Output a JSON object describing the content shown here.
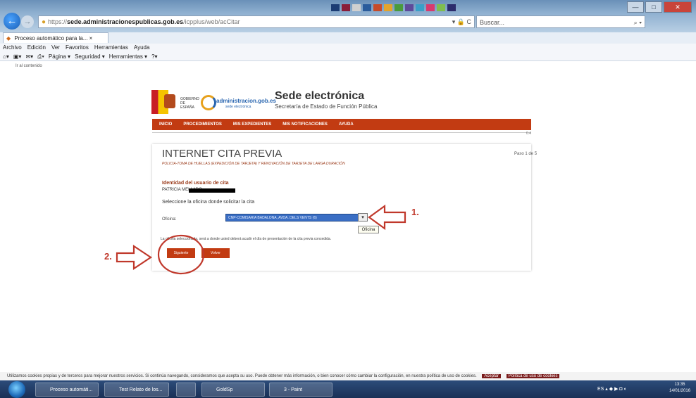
{
  "browser": {
    "url_prefix": "https://",
    "url_host": "sede.administracionespublicas.gob.es",
    "url_path": "/icpplus/web/acCitar",
    "url_controls": "▾ 🔒 C",
    "search_placeholder": "Buscar...",
    "tab_title": "Proceso automático para la... ×",
    "window_controls": [
      "—",
      "□",
      "✕"
    ],
    "menu": [
      "Archivo",
      "Edición",
      "Ver",
      "Favoritos",
      "Herramientas",
      "Ayuda"
    ],
    "commands": [
      "Página ▾",
      "Seguridad ▾",
      "Herramientas ▾"
    ]
  },
  "page": {
    "skip_link": "Ir al contenido",
    "gov_text": "GOBIERNO DE ESPAÑA",
    "admin_logo": "administracion.gob.es",
    "admin_logo_sub": "sede electrónica",
    "sede_title": "Sede electrónica",
    "sede_subtitle": "Secretaría de Estado de Función Pública",
    "nav": [
      "INICIO",
      "PROCEDIMIENTOS",
      "MIS EXPEDIENTES",
      "MIS NOTIFICACIONES",
      "AYUDA"
    ],
    "zoom": "0.4",
    "title": "INTERNET CITA PREVIA",
    "step": "Paso 1 de 5",
    "subtitle": "POLICIA-TOMA DE HUELLAS (EXPEDICIÓN DE TARJETA) Y RENOVACIÓN DE TARJETA DE LARGA DURACIÓN",
    "identity_label": "Identidad del usuario de cita",
    "user_name": "PATRICIA MELLADO",
    "select_prompt": "Seleccione la oficina donde solicitar la cita",
    "office_label": "Oficina:",
    "office_value": "CNP-COMISARIA BADALONA, AVDA. DELS VENTS (6)",
    "tooltip": "Oficina",
    "note": "La oficina seleccionada, será a donde usted deberá acudir el día de presentación de la cita previa concedida.",
    "next_button": "Siguiente",
    "back_button": "Volver"
  },
  "annotations": {
    "one": "1.",
    "two": "2."
  },
  "cookie": {
    "text": "Utilizamos cookies propias y de terceros para mejorar nuestros servicios. Si continúa navegando, consideramos que acepta su uso. Puede obtener más información, o bien conocer cómo cambiar la configuración, en nuestra política de uso de cookies.",
    "accept": "Aceptar",
    "policy": "Política de uso de cookies"
  },
  "taskbar": {
    "items": [
      "Proceso automáti...",
      "Test Relato de los...",
      "",
      "GoldSp",
      "3 - Paint"
    ],
    "tray": "ES ▴ ◆ ▶ ◘ ◐",
    "time": "13:35",
    "date": "14/01/2016"
  },
  "colors": {
    "brand_red": "#c23b12",
    "annotation_red": "#c0382b"
  }
}
